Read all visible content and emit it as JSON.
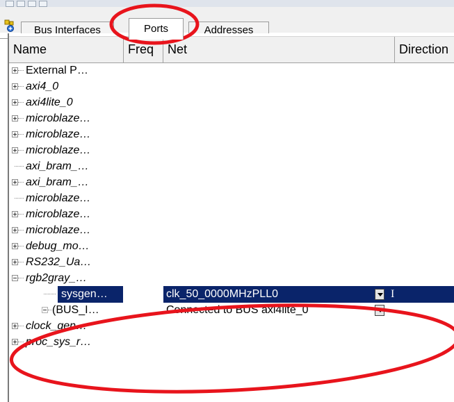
{
  "tabs": [
    {
      "label": "Bus Interfaces"
    },
    {
      "label": "Ports"
    },
    {
      "label": "Addresses"
    }
  ],
  "columns": {
    "name": "Name",
    "freq": "Freq",
    "net": "Net",
    "direction": "Direction"
  },
  "rows": [
    {
      "name": "External P…",
      "italic": false,
      "expander": "plus"
    },
    {
      "name": "axi4_0",
      "italic": true,
      "expander": "plus"
    },
    {
      "name": "axi4lite_0",
      "italic": true,
      "expander": "plus"
    },
    {
      "name": "microblaze…",
      "italic": true,
      "expander": "plus"
    },
    {
      "name": "microblaze…",
      "italic": true,
      "expander": "plus"
    },
    {
      "name": "microblaze…",
      "italic": true,
      "expander": "plus"
    },
    {
      "name": "axi_bram_…",
      "italic": true,
      "expander": "none"
    },
    {
      "name": "axi_bram_…",
      "italic": true,
      "expander": "plus"
    },
    {
      "name": "microblaze…",
      "italic": true,
      "expander": "none"
    },
    {
      "name": "microblaze…",
      "italic": true,
      "expander": "plus"
    },
    {
      "name": "microblaze…",
      "italic": true,
      "expander": "plus"
    },
    {
      "name": "debug_mo…",
      "italic": true,
      "expander": "plus"
    },
    {
      "name": "RS232_Ua…",
      "italic": true,
      "expander": "plus"
    },
    {
      "name": "rgb2gray_…",
      "italic": true,
      "expander": "minus"
    }
  ],
  "child_rows": [
    {
      "name": "sysgen…",
      "net": "clk_50_0000MHzPLL0",
      "direction": "I",
      "selected": true
    },
    {
      "name": "(BUS_I…",
      "net": "Connected to BUS axi4lite_0",
      "direction": "",
      "selected": false
    }
  ],
  "tail_rows": [
    {
      "name": "clock_gen…",
      "italic": true,
      "expander": "plus"
    },
    {
      "name": "proc_sys_r…",
      "italic": true,
      "expander": "plus"
    }
  ],
  "colors": {
    "selection": "#0a246a",
    "annotation": "#e8141c"
  },
  "icons": {
    "corner": "add-ip-icon",
    "dropdown": "chevron-down-icon"
  }
}
